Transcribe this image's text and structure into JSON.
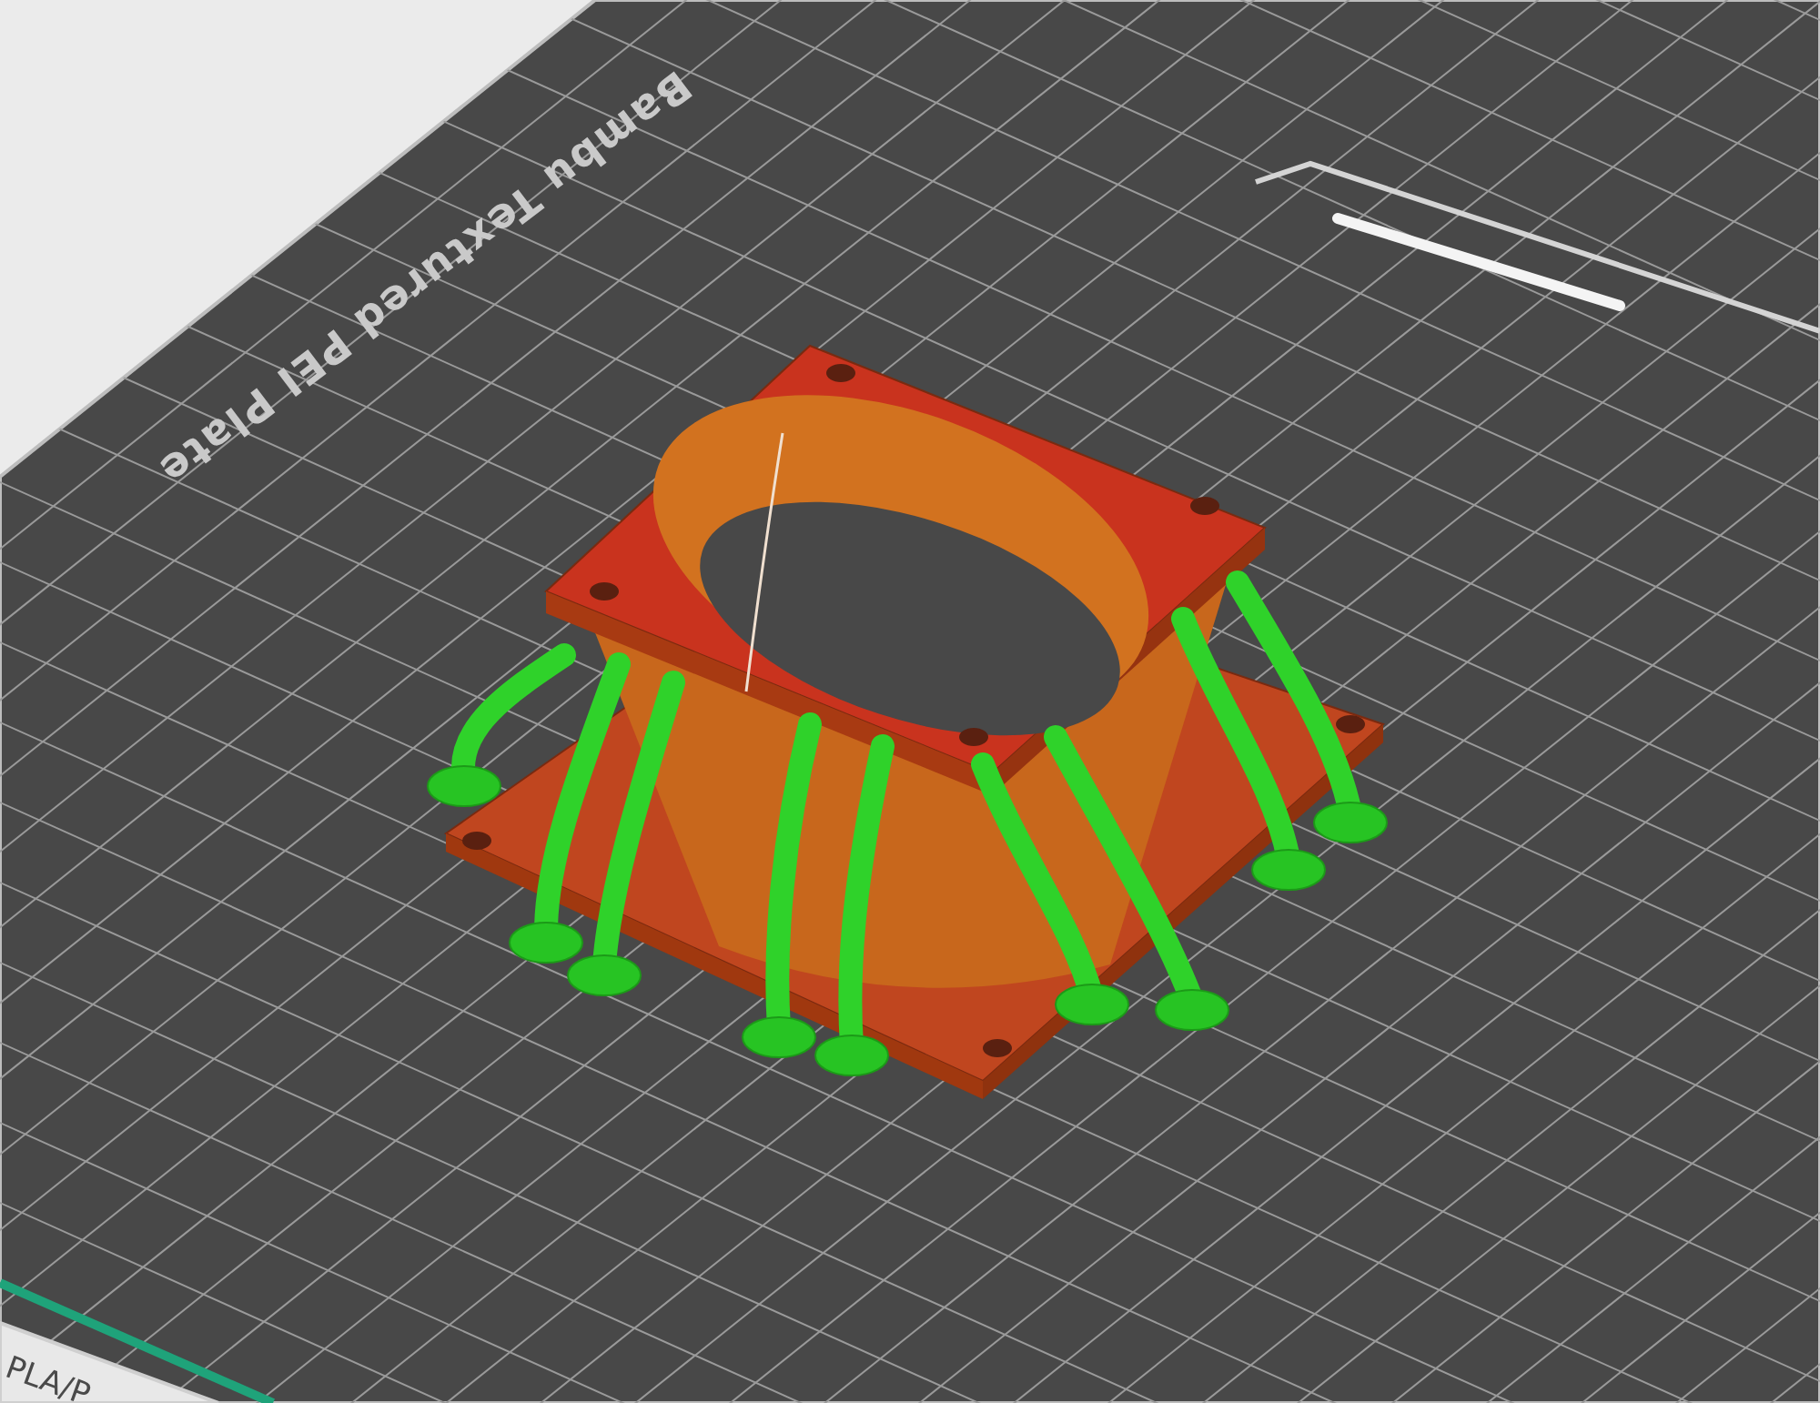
{
  "build_plate": {
    "label": "Bambu Textured PEI Plate"
  },
  "filament_tag": {
    "label": "PLA/P"
  }
}
